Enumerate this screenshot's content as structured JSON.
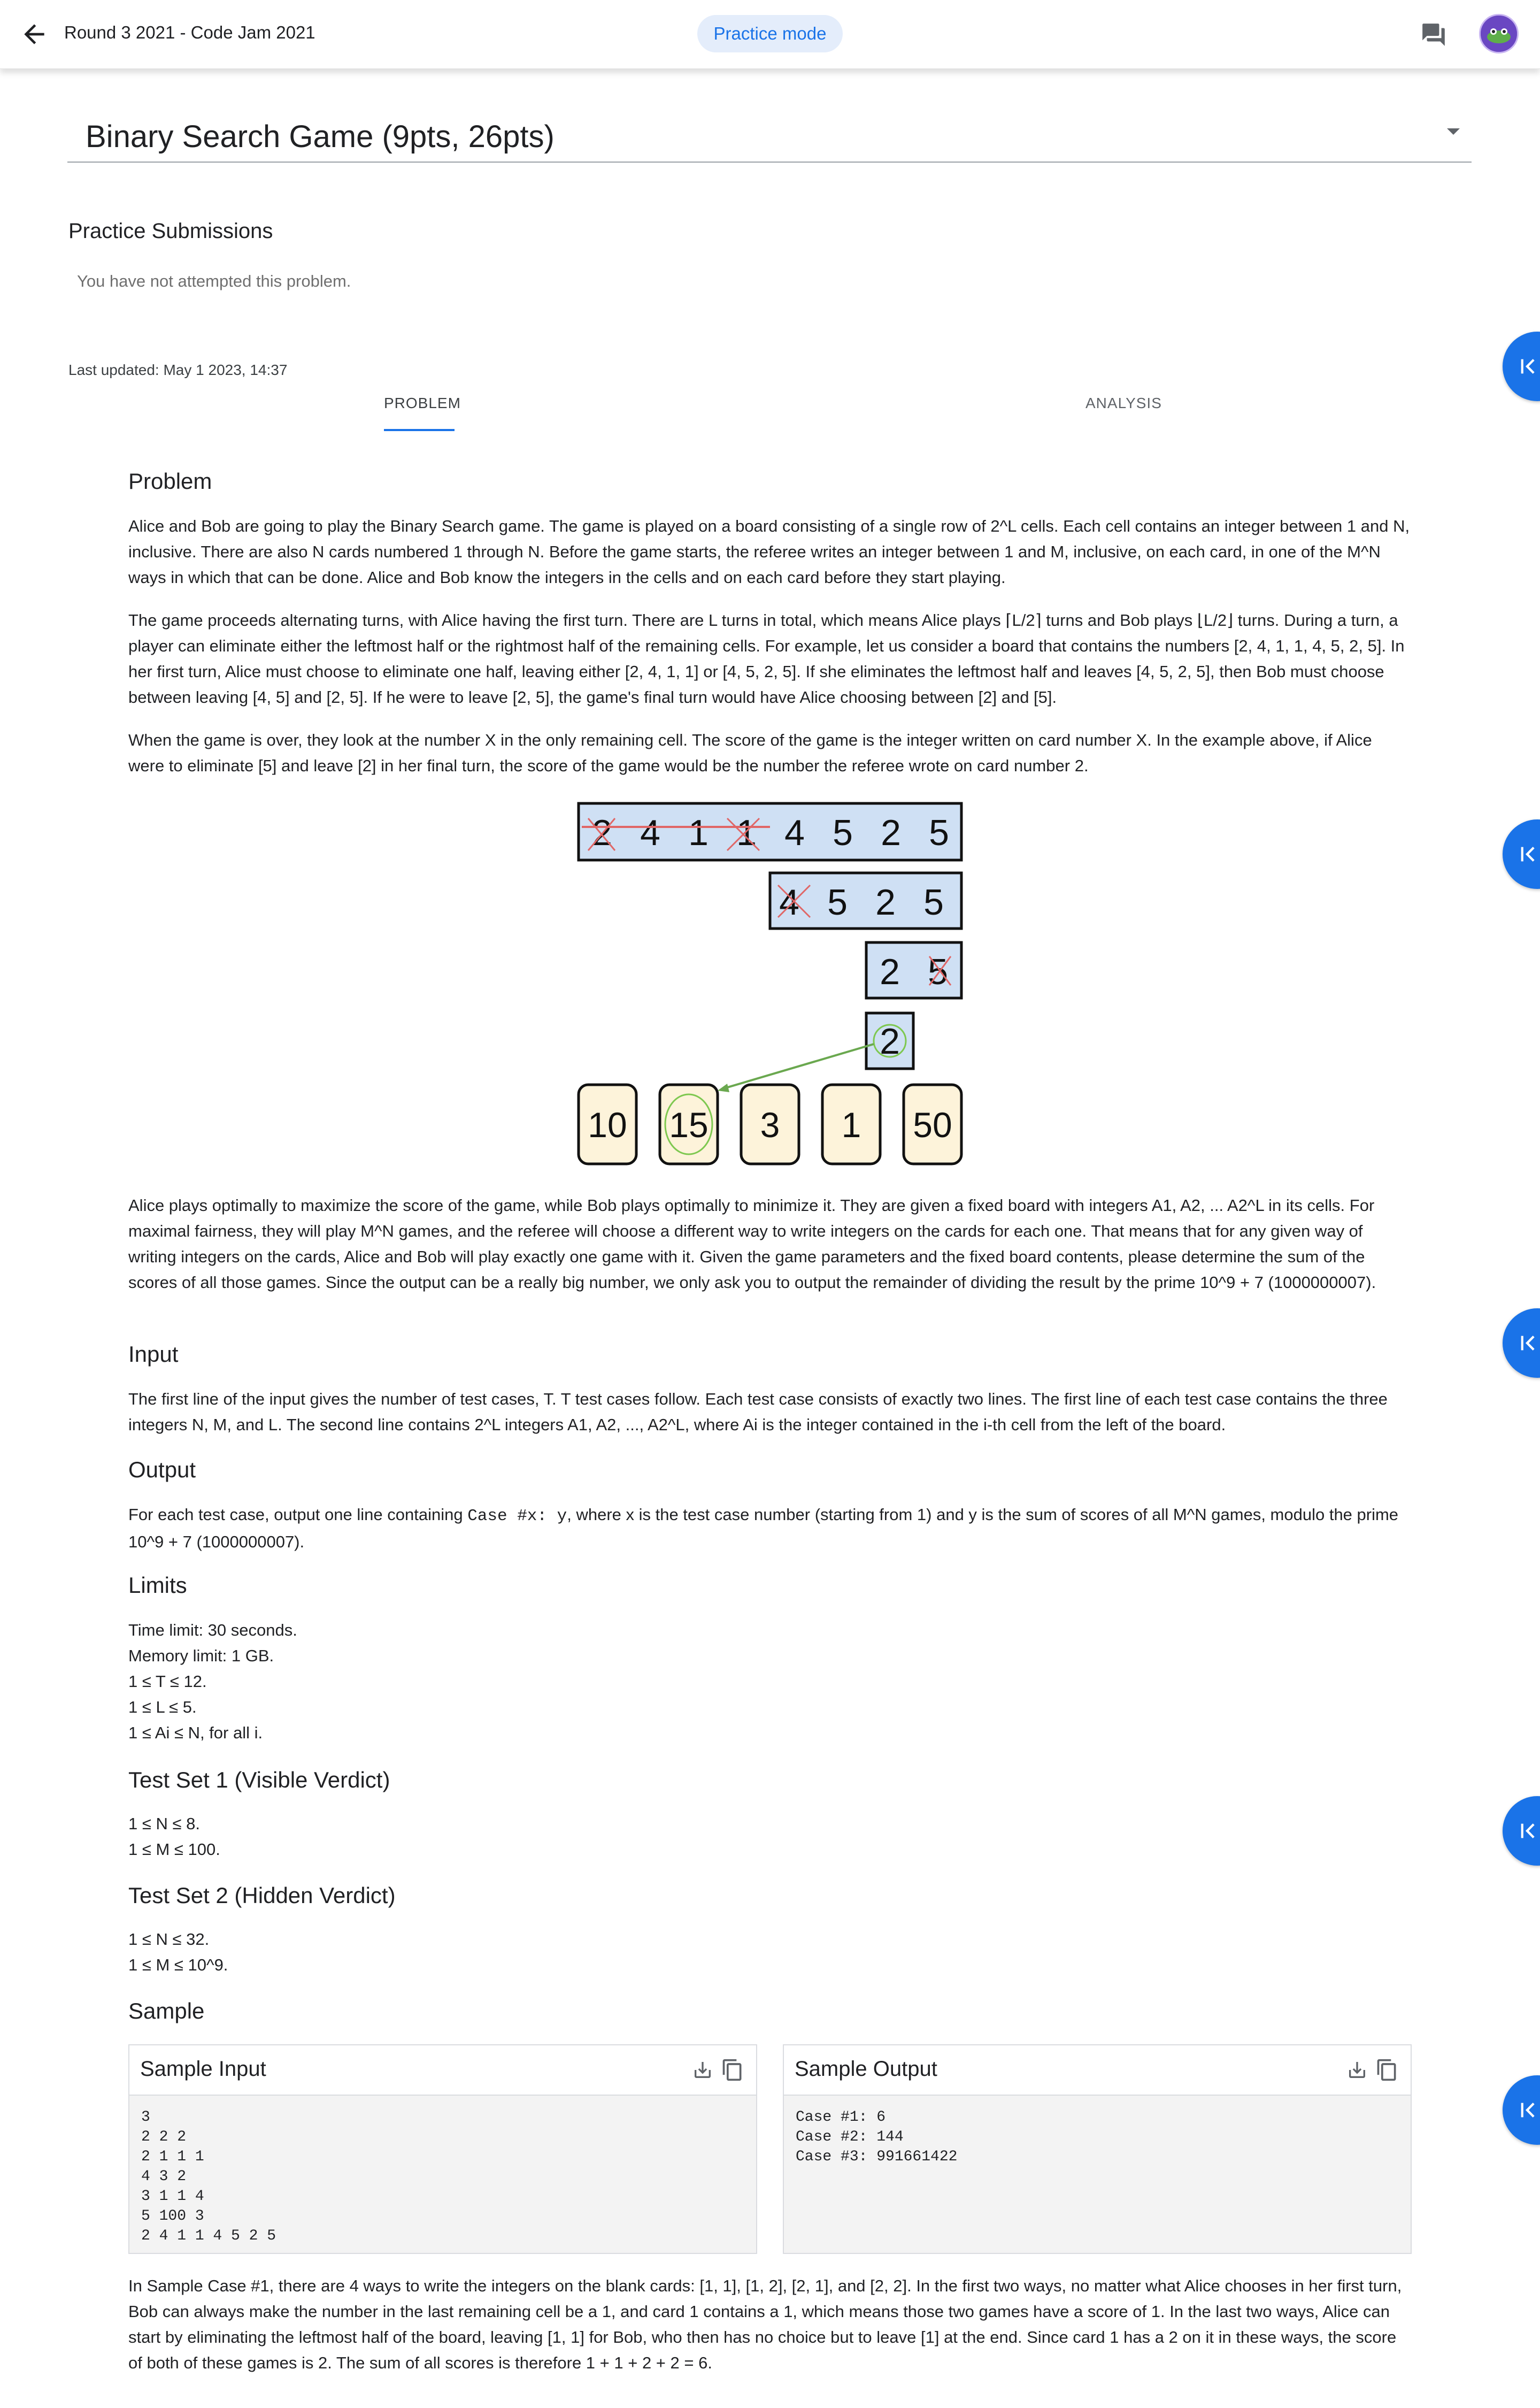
{
  "header": {
    "title": "Round 3 2021 - Code Jam 2021",
    "mode_chip": "Practice mode"
  },
  "problem_select": {
    "title": "Binary Search Game (9pts, 26pts)"
  },
  "submissions": {
    "heading": "Practice Submissions",
    "empty_text": "You have not attempted this problem."
  },
  "last_updated": "Last updated: May 1 2023, 14:37",
  "tabs": [
    {
      "label": "PROBLEM"
    },
    {
      "label": "ANALYSIS"
    }
  ],
  "problem": {
    "heading": "Problem",
    "p1": "Alice and Bob are going to play the Binary Search game. The game is played on a board consisting of a single row of 2^L cells. Each cell contains an integer between 1 and N, inclusive. There are also N cards numbered 1 through N. Before the game starts, the referee writes an integer between 1 and M, inclusive, on each card, in one of the M^N ways in which that can be done. Alice and Bob know the integers in the cells and on each card before they start playing.",
    "p2": "The game proceeds alternating turns, with Alice having the first turn. There are L turns in total, which means Alice plays ⌈L/2⌉ turns and Bob plays ⌊L/2⌋ turns. During a turn, a player can eliminate either the leftmost half or the rightmost half of the remaining cells. For example, let us consider a board that contains the numbers [2, 4, 1, 1, 4, 5, 2, 5]. In her first turn, Alice must choose to eliminate one half, leaving either [2, 4, 1, 1] or [4, 5, 2, 5]. If she eliminates the leftmost half and leaves [4, 5, 2, 5], then Bob must choose between leaving [4, 5] and [2, 5]. If he were to leave [2, 5], the game's final turn would have Alice choosing between [2] and [5].",
    "p3": "When the game is over, they look at the number X in the only remaining cell. The score of the game is the integer written on card number X. In the example above, if Alice were to eliminate [5] and leave [2] in her final turn, the score of the game would be the number the referee wrote on card number 2.",
    "p4": "Alice plays optimally to maximize the score of the game, while Bob plays optimally to minimize it. They are given a fixed board with integers A1, A2, ... A2^L in its cells. For maximal fairness, they will play M^N games, and the referee will choose a different way to write integers on the cards for each one. That means that for any given way of writing integers on the cards, Alice and Bob will play exactly one game with it. Given the game parameters and the fixed board contents, please determine the sum of the scores of all those games. Since the output can be a really big number, we only ask you to output the remainder of dividing the result by the prime 10^9 + 7 (1000000007)."
  },
  "figure": {
    "rows": [
      [
        "2",
        "4",
        "1",
        "1",
        "4",
        "5",
        "2",
        "5"
      ],
      [
        "4",
        "5",
        "2",
        "5"
      ],
      [
        "2",
        "5"
      ],
      [
        "2"
      ]
    ],
    "cards": [
      "10",
      "15",
      "3",
      "1",
      "50"
    ],
    "colors": {
      "cell_fill": "#cfe0f4",
      "card_fill": "#fdf3da",
      "strike": "#e06666",
      "highlight": "#7ec850",
      "arrow": "#6aa84f"
    }
  },
  "input": {
    "heading": "Input",
    "text": "The first line of the input gives the number of test cases, T. T test cases follow. Each test case consists of exactly two lines. The first line of each test case contains the three integers N, M, and L. The second line contains 2^L integers A1, A2, ..., A2^L, where Ai is the integer contained in the i-th cell from the left of the board."
  },
  "output": {
    "heading": "Output",
    "text_a": "For each test case, output one line containing ",
    "code": "Case #x: y",
    "text_b": ", where x is the test case number (starting from 1) and y is the sum of scores of all M^N games, modulo the prime 10^9 + 7 (1000000007)."
  },
  "limits": {
    "heading": "Limits",
    "lines": [
      "Time limit: 30 seconds.",
      "Memory limit: 1 GB.",
      "1 ≤ T ≤ 12.",
      "1 ≤ L ≤ 5.",
      "1 ≤ Ai ≤ N, for all i."
    ]
  },
  "test_set_1": {
    "heading": "Test Set 1 (Visible Verdict)",
    "lines": [
      "1 ≤ N ≤ 8.",
      "1 ≤ M ≤ 100."
    ]
  },
  "test_set_2": {
    "heading": "Test Set 2 (Hidden Verdict)",
    "lines": [
      "1 ≤ N ≤ 32.",
      "1 ≤ M ≤ 10^9."
    ]
  },
  "sample": {
    "heading": "Sample",
    "input_label": "Sample Input",
    "output_label": "Sample Output",
    "input_text": "3\n2 2 2\n2 1 1 1\n4 3 2\n3 1 1 4\n5 100 3\n2 4 1 1 4 5 2 5",
    "output_text": "Case #1: 6\nCase #2: 144\nCase #3: 991661422",
    "explanation": "In Sample Case #1, there are 4 ways to write the integers on the blank cards: [1, 1], [1, 2], [2, 1], and [2, 2]. In the first two ways, no matter what Alice chooses in her first turn, Bob can always make the number in the last remaining cell be a 1, and card 1 contains a 1, which means those two games have a score of 1. In the last two ways, Alice can start by eliminating the leftmost half of the board, leaving [1, 1] for Bob, who then has no choice but to leave [1] at the end. Since card 1 has a 2 on it in these ways, the score of both of these games is 2. The sum of all scores is therefore 1 + 1 + 2 + 2 = 6."
  },
  "icons": {
    "back": "arrow-back-icon",
    "chat": "chat-icon",
    "side_toggle": "first-page-icon",
    "download": "download-icon",
    "copy": "copy-icon"
  }
}
